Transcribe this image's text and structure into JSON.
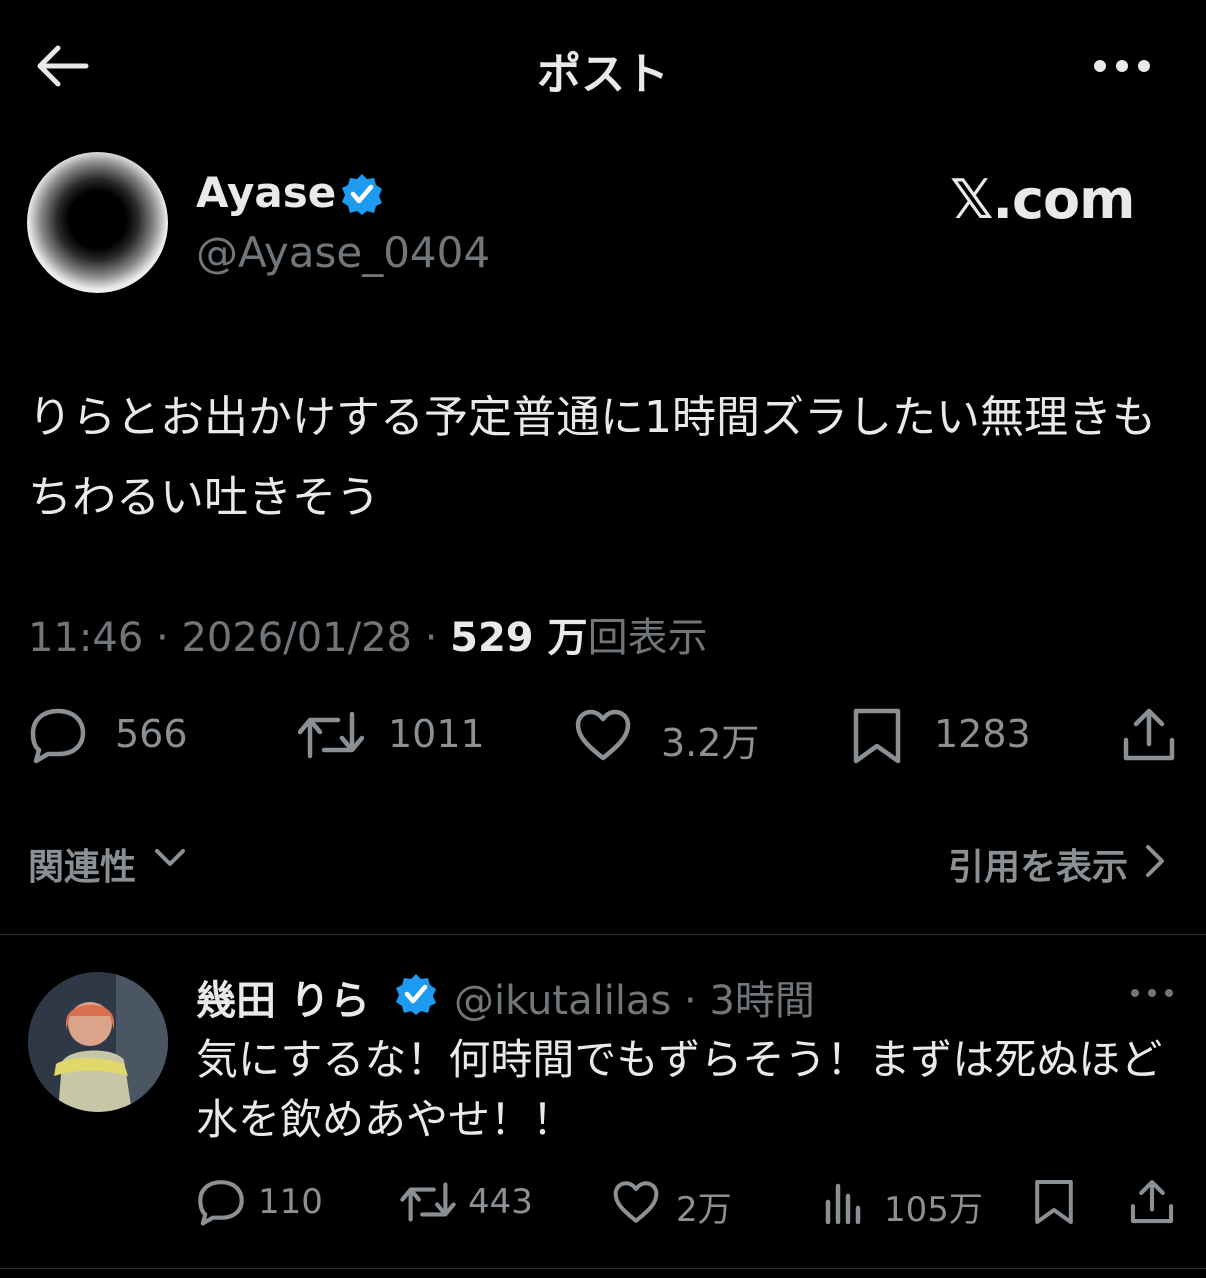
{
  "header": {
    "title": "ポスト",
    "back_icon": "arrow-left-icon",
    "more_icon": "more-horizontal-icon"
  },
  "post": {
    "author_name": "Ayase",
    "author_handle": "@Ayase_0404",
    "verified_color": "#1d9bf0",
    "watermark": "𝕏.com",
    "text": "りらとお出かけする予定普通に1時間ズラしたい無理きもちわるい吐きそう",
    "time": "11:46",
    "date": "2026/01/28",
    "views_number": "529 万",
    "views_label": "回表示",
    "separator": "·",
    "stats": {
      "replies": "566",
      "reposts": "1011",
      "likes": "3.2万",
      "bookmarks": "1283"
    }
  },
  "sort": {
    "label": "関連性",
    "quotes_label": "引用を表示"
  },
  "reply": {
    "author_name": "幾田 りら",
    "author_handle": "@ikutalilas",
    "time": "3時間",
    "text": "気にするな！何時間でもずらそう！まずは死ぬほど水を飲めあやせ！！",
    "stats": {
      "replies": "110",
      "reposts": "443",
      "likes": "2万",
      "views": "105万"
    }
  },
  "colors": {
    "background": "#000000",
    "text": "#e7e9ea",
    "secondary": "#71767b",
    "accent": "#1d9bf0"
  }
}
